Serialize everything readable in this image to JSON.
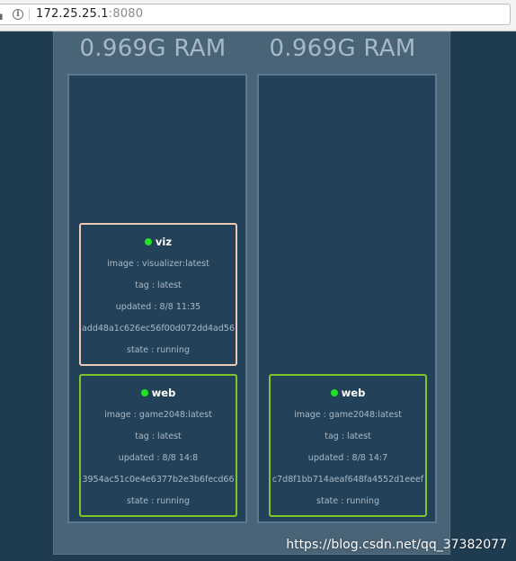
{
  "browser": {
    "url_host": "172.25.25.1",
    "url_port": ":8080"
  },
  "nodes": [
    {
      "title": "0.969G RAM",
      "services": [
        {
          "name": "viz",
          "image": "image : visualizer:latest",
          "tag": "tag : latest",
          "updated": "updated : 8/8 11:35",
          "id": "add48a1c626ec56f00d072dd4ad56",
          "state": "state : running",
          "status_color": "#22e322"
        },
        {
          "name": "web",
          "image": "image : game2048:latest",
          "tag": "tag : latest",
          "updated": "updated : 8/8 14:8",
          "id": "3954ac51c0e4e6377b2e3b6fecd66",
          "state": "state : running",
          "status_color": "#22e322"
        }
      ]
    },
    {
      "title": "0.969G RAM",
      "services": [
        {
          "name": "web",
          "image": "image : game2048:latest",
          "tag": "tag : latest",
          "updated": "updated : 8/8 14:7",
          "id": "c7d8f1bb714aeaf648fa4552d1eeef",
          "state": "state : running",
          "status_color": "#22e322"
        }
      ]
    }
  ],
  "colors": {
    "background": "#1f3b4f",
    "cluster": "#4a6477",
    "node": "#23425a",
    "viz_border": "#f0c8b8",
    "web_border": "#7fc62a",
    "running_dot": "#22e322"
  },
  "watermark": "https://blog.csdn.net/qq_37382077"
}
